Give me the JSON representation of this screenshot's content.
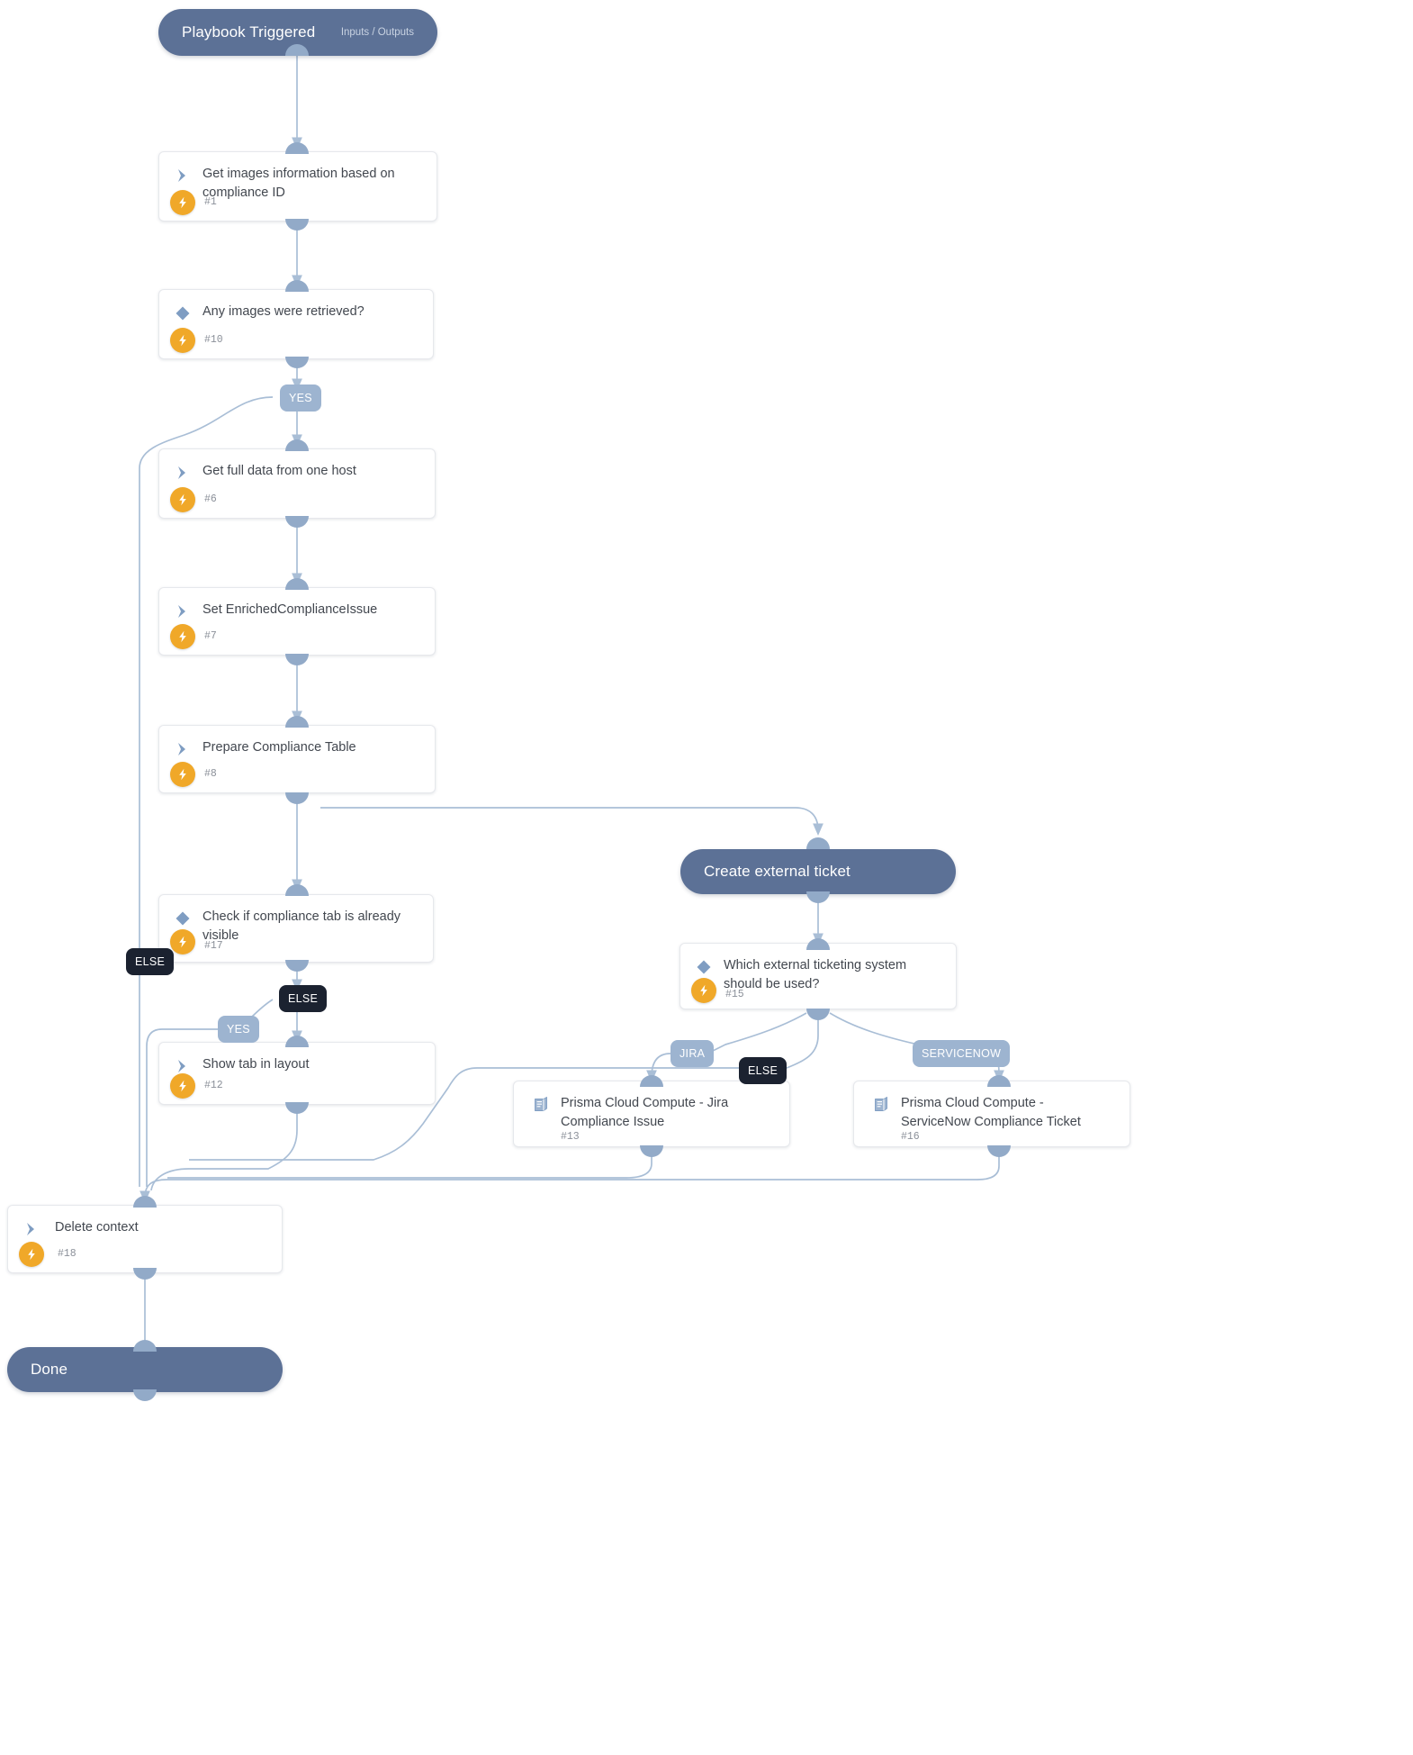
{
  "diagram": {
    "type": "playbook-workflow",
    "colors": {
      "section_pill": "#5c7196",
      "card_background": "#ffffff",
      "edge": "#a9bed6",
      "badge_orange": "#f0a829",
      "branch_yes": "#9db4d0",
      "branch_else": "#1b2230",
      "icon_blue": "#7f9dc2"
    }
  },
  "sections": [
    {
      "id": "start",
      "title": "Playbook Triggered",
      "subtitle": "Inputs / Outputs"
    },
    {
      "id": "external",
      "title": "Create external ticket",
      "subtitle": ""
    },
    {
      "id": "done",
      "title": "Done",
      "subtitle": ""
    }
  ],
  "tasks": [
    {
      "id": "t1",
      "title": "Get images information based on compliance ID",
      "number": "#1",
      "icon": "chevron-icon",
      "badge": "lightning-icon"
    },
    {
      "id": "t10",
      "title": "Any images were retrieved?",
      "number": "#10",
      "icon": "diamond-icon",
      "badge": "lightning-icon"
    },
    {
      "id": "t6",
      "title": "Get full data from one host",
      "number": "#6",
      "icon": "chevron-icon",
      "badge": "lightning-icon"
    },
    {
      "id": "t7",
      "title": "Set EnrichedComplianceIssue",
      "number": "#7",
      "icon": "chevron-icon",
      "badge": "lightning-icon"
    },
    {
      "id": "t8",
      "title": "Prepare Compliance Table",
      "number": "#8",
      "icon": "chevron-icon",
      "badge": "lightning-icon"
    },
    {
      "id": "t17",
      "title": "Check if compliance tab is already visible",
      "number": "#17",
      "icon": "diamond-icon",
      "badge": "lightning-icon"
    },
    {
      "id": "t12",
      "title": "Show tab in layout",
      "number": "#12",
      "icon": "chevron-icon",
      "badge": "lightning-icon"
    },
    {
      "id": "t15",
      "title": "Which external ticketing system should be used?",
      "number": "#15",
      "icon": "diamond-icon",
      "badge": "lightning-icon"
    },
    {
      "id": "t13",
      "title": "Prisma Cloud Compute - Jira Compliance Issue",
      "number": "#13",
      "icon": "playbook-icon",
      "badge": ""
    },
    {
      "id": "t16",
      "title": "Prisma Cloud Compute - ServiceNow Compliance Ticket",
      "number": "#16",
      "icon": "playbook-icon",
      "badge": ""
    },
    {
      "id": "t18",
      "title": "Delete context",
      "number": "#18",
      "icon": "chevron-icon",
      "badge": "lightning-icon"
    }
  ],
  "branch_labels": [
    {
      "id": "b1",
      "text": "YES",
      "style": "yes"
    },
    {
      "id": "b2",
      "text": "ELSE",
      "style": "else"
    },
    {
      "id": "b3",
      "text": "ELSE",
      "style": "else"
    },
    {
      "id": "b4",
      "text": "YES",
      "style": "yes"
    },
    {
      "id": "b5",
      "text": "JIRA",
      "style": "yes"
    },
    {
      "id": "b6",
      "text": "ELSE",
      "style": "else"
    },
    {
      "id": "b7",
      "text": "SERVICENOW",
      "style": "yes"
    }
  ]
}
